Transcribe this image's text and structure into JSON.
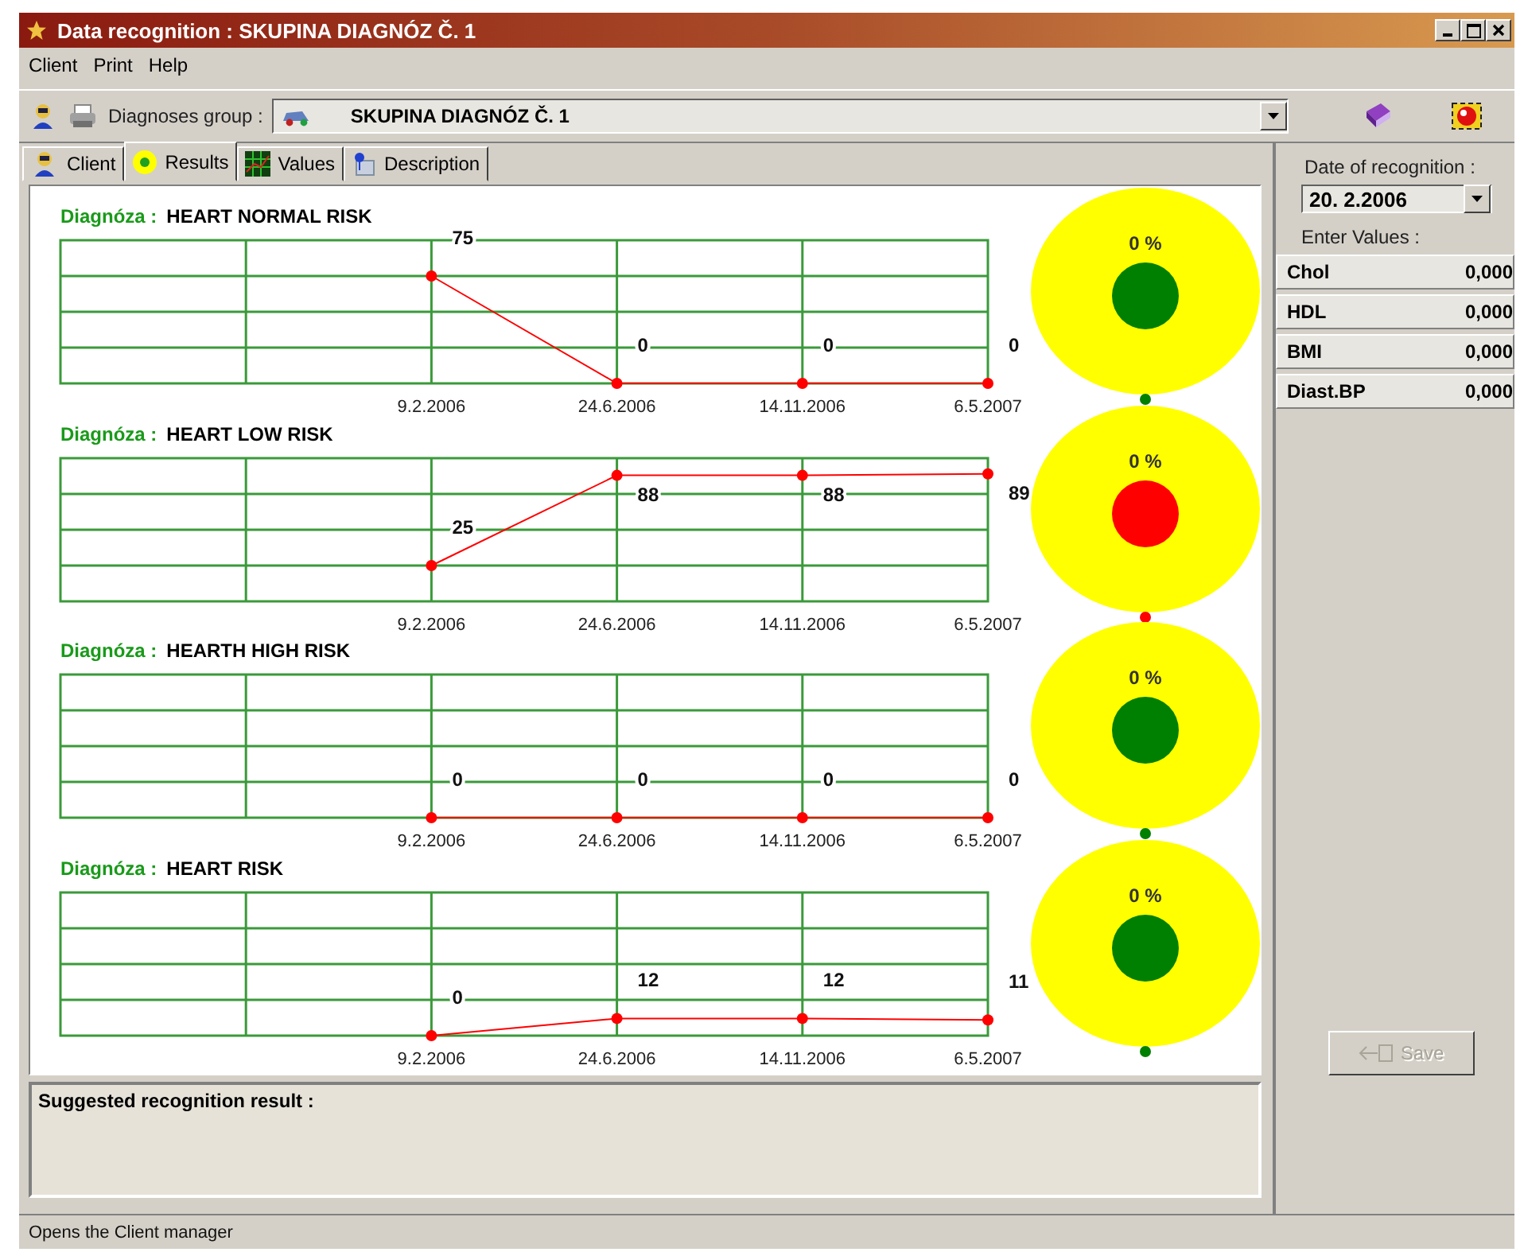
{
  "window": {
    "title": "Data recognition : SKUPINA DIAGNÓZ Č. 1"
  },
  "menu": [
    "Client",
    "Print",
    "Help"
  ],
  "toolbar": {
    "group_label": "Diagnoses group :",
    "group_value": "SKUPINA DIAGNÓZ Č. 1"
  },
  "tabs": [
    {
      "label": "Client",
      "selected": false
    },
    {
      "label": "Results",
      "selected": true
    },
    {
      "label": "Values",
      "selected": false
    },
    {
      "label": "Description",
      "selected": false
    }
  ],
  "diagnoses": [
    {
      "label": "Diagnóza :",
      "name": "HEART NORMAL RISK",
      "percent": "0 %",
      "color": "#008000",
      "chart_data": {
        "type": "line",
        "categories": [
          "9.2.2006",
          "24.6.2006",
          "14.11.2006",
          "6.5.2007"
        ],
        "ylim": [
          0,
          100
        ],
        "grid": true,
        "data_labels": true,
        "series": [
          {
            "color": "#ff0000",
            "marker": "circle",
            "values": [
              75,
              0,
              0,
              0
            ]
          }
        ]
      }
    },
    {
      "label": "Diagnóza :",
      "name": "HEART LOW RISK",
      "percent": "0 %",
      "color": "#ff0000",
      "chart_data": {
        "type": "line",
        "categories": [
          "9.2.2006",
          "24.6.2006",
          "14.11.2006",
          "6.5.2007"
        ],
        "ylim": [
          0,
          100
        ],
        "grid": true,
        "data_labels": true,
        "series": [
          {
            "color": "#ff0000",
            "marker": "circle",
            "values": [
              25,
              88,
              88,
              89
            ]
          }
        ]
      }
    },
    {
      "label": "Diagnóza :",
      "name": "HEARTH HIGH RISK",
      "percent": "0 %",
      "color": "#008000",
      "plot": {
        "categories": [
          "9.2.2006",
          "24.6.2006",
          "14.11.2006",
          "6.5.2007"
        ],
        "labels": [
          "0",
          "0",
          "0",
          "0"
        ]
      }
    },
    {
      "label": "Diagnóza :",
      "name": "HEART RISK",
      "percent": "0 %",
      "color": "#008000",
      "chart_data": {
        "type": "line",
        "categories": [
          "9.2.2006",
          "24.6.2006",
          "14.11.2006",
          "6.5.2007"
        ],
        "ylim": [
          0,
          100
        ],
        "grid": true,
        "data_labels": true,
        "series": [
          {
            "color": "#ff0000",
            "marker": "circle",
            "values": [
              0,
              12,
              12,
              11
            ]
          }
        ]
      }
    }
  ],
  "suggested": {
    "label": "Suggested recognition result :"
  },
  "recognition": {
    "date_label": "Date of recognition :",
    "date": "20. 2.2006",
    "values_label": "Enter Values :",
    "values": [
      {
        "name": "Chol",
        "value": "0,000"
      },
      {
        "name": "HDL",
        "value": "0,000"
      },
      {
        "name": "BMI",
        "value": "0,000"
      },
      {
        "name": "Diast.BP",
        "value": "0,000"
      }
    ],
    "save": {
      "label": "Save",
      "disabled": true
    }
  },
  "status_bar": "Opens the Client manager"
}
